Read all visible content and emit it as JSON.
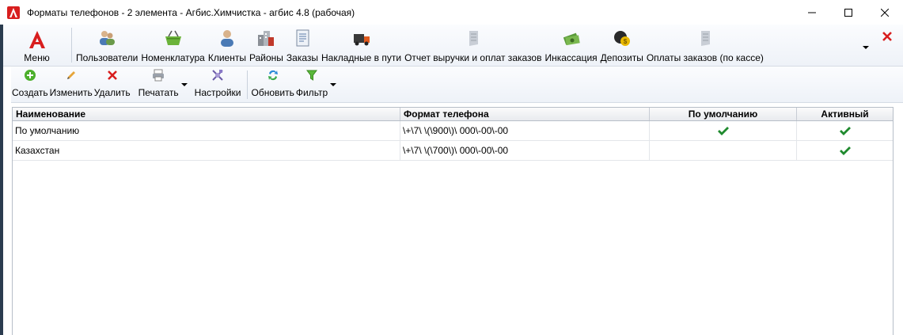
{
  "window": {
    "title": "Форматы телефонов - 2 элемента - Агбис.Химчистка - агбис 4.8 (рабочая)",
    "controls": [
      {
        "name": "minimize-button",
        "icon": "minimize-icon"
      },
      {
        "name": "maximize-button",
        "icon": "maximize-icon"
      },
      {
        "name": "close-window-button",
        "icon": "close-icon"
      }
    ]
  },
  "ribbon": {
    "menu_label": "Меню",
    "items": [
      {
        "name": "users",
        "label": "Пользователи",
        "icon": "users-icon"
      },
      {
        "name": "nomenclature",
        "label": "Номенклатура",
        "icon": "basket-icon"
      },
      {
        "name": "clients",
        "label": "Клиенты",
        "icon": "client-icon"
      },
      {
        "name": "districts",
        "label": "Районы",
        "icon": "buildings-icon"
      },
      {
        "name": "orders",
        "label": "Заказы",
        "icon": "document-icon"
      },
      {
        "name": "waybills",
        "label": "Накладные в пути",
        "icon": "truck-icon"
      },
      {
        "name": "revenue-report",
        "label": "Отчет выручки и оплат заказов",
        "icon": "report-icon"
      },
      {
        "name": "collection",
        "label": "Инкассация",
        "icon": "money-icon"
      },
      {
        "name": "deposits",
        "label": "Депозиты",
        "icon": "coins-icon"
      },
      {
        "name": "order-payments",
        "label": "Оплаты заказов (по кассе)",
        "icon": "report-icon"
      }
    ]
  },
  "toolbar": {
    "create_label": "Создать",
    "edit_label": "Изменить",
    "delete_label": "Удалить",
    "print_label": "Печатать",
    "settings_label": "Настройки",
    "refresh_label": "Обновить",
    "filter_label": "Фильтр"
  },
  "table": {
    "columns": [
      "Наименование",
      "Формат телефона",
      "По умолчанию",
      "Активный"
    ],
    "rows": [
      {
        "name": "По умолчанию",
        "format": "\\+\\7\\ \\(\\900\\)\\ 000\\-00\\-00",
        "default": true,
        "active": true
      },
      {
        "name": "Казахстан",
        "format": "\\+\\7\\ \\(\\700\\)\\ 000\\-00\\-00",
        "default": false,
        "active": true
      }
    ]
  },
  "colors": {
    "accent_red": "#d81e1e",
    "check_green": "#1f8a2e",
    "ribbon_bg": "#eef2f8",
    "grid_border": "#b7bec8"
  }
}
